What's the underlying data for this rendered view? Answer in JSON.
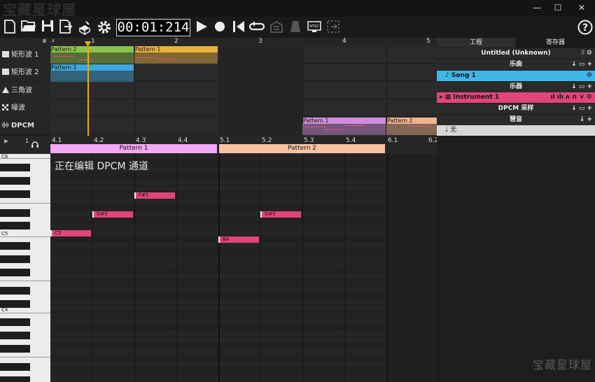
{
  "watermark_text": "宝藏星球屋",
  "window": {
    "minimize": "—",
    "maximize": "☐",
    "close": "✕"
  },
  "toolbar": {
    "time": "00:01:214",
    "help": "?"
  },
  "channels": [
    {
      "label": "矩形波 1",
      "icon": "square"
    },
    {
      "label": "矩形波 2",
      "icon": "square"
    },
    {
      "label": "三角波",
      "icon": "triangle"
    },
    {
      "label": "噪波",
      "icon": "noise"
    },
    {
      "label": "DPCM",
      "icon": "dpcm"
    }
  ],
  "sequencer": {
    "bar_numbers": [
      "1",
      "2",
      "3",
      "4",
      "5"
    ],
    "patterns": [
      {
        "channel": 0,
        "label": "Pattern 2",
        "color": "#8bc34a"
      },
      {
        "channel": 0,
        "label": "Pattern 1",
        "color": "#e8b23a"
      },
      {
        "channel": 1,
        "label": "Pattern 1",
        "color": "#3fa7dc"
      },
      {
        "channel": 4,
        "label": "Pattern 1",
        "color": "#d08de0"
      },
      {
        "channel": 4,
        "label": "Pattern 2",
        "color": "#f0b48a"
      }
    ]
  },
  "piano_roll": {
    "frame_number": "1",
    "beat_labels": [
      "4.1",
      "4.2",
      "4.3",
      "4.4",
      "5.1",
      "5.2",
      "5.3",
      "5.4",
      "6.1",
      "6.2"
    ],
    "patterns": [
      {
        "label": "Pattern 1",
        "color": "#f2a8f5"
      },
      {
        "label": "Pattern 2",
        "color": "#f7c4a2"
      }
    ],
    "octave_labels": [
      "C6",
      "C5",
      "C4"
    ],
    "editing_message": "正在编辑 DPCM 通道",
    "notes": [
      {
        "label": "F#5"
      },
      {
        "label": "D#5"
      },
      {
        "label": "D#5"
      },
      {
        "label": "C5"
      },
      {
        "label": "B4"
      }
    ]
  },
  "right_panel": {
    "tabs": [
      "工程",
      "寄存器"
    ],
    "project_title": "Untitled (Unknown)",
    "songs_header": "乐曲",
    "song_item": "Song 1",
    "instruments_header": "乐器",
    "instrument_item": "Instrument 1",
    "dpcm_header": "DPCM 采样",
    "arpeggio_header": "琶音",
    "arpeggio_item": "无"
  }
}
